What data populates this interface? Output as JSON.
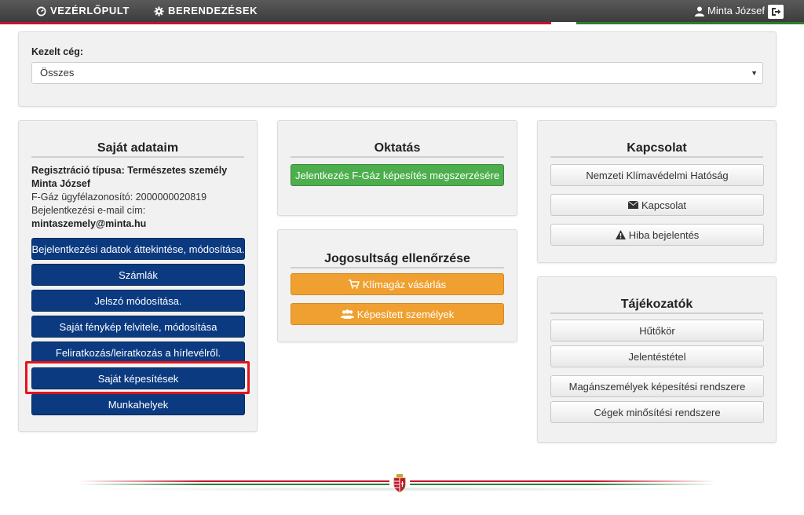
{
  "nav": {
    "dashboard_label": "VEZÉRLŐPULT",
    "devices_label": "BERENDEZÉSEK",
    "user_name": "Minta József"
  },
  "company": {
    "label": "Kezelt cég:",
    "selected": "Összes"
  },
  "own_data": {
    "title": "Saját adataim",
    "registration_type": "Regisztráció típusa: Természetes személy",
    "name": "Minta József",
    "client_id": "F-Gáz ügyfélazonosító: 2000000020819",
    "email_label": "Bejelentkezési e-mail cím:",
    "email": "mintaszemely@minta.hu",
    "buttons": [
      "Bejelentkezési adatok áttekintése, módosítása.",
      "Számlák",
      "Jelszó módosítása.",
      "Saját fénykép felvitele, módosítása",
      "Feliratkozás/leiratkozás a hírlevélről.",
      "Saját képesítések",
      "Munkahelyek"
    ]
  },
  "education": {
    "title": "Oktatás",
    "button": "Jelentkezés F-Gáz képesítés megszerzésére"
  },
  "eligibility": {
    "title": "Jogosultság ellenőrzése",
    "buy_button": "Klímagáz vásárlás",
    "persons_button": "Képesített személyek"
  },
  "contact": {
    "title": "Kapcsolat",
    "buttons": [
      "Nemzeti Klímavédelmi Hatóság",
      "Kapcsolat",
      "Hiba bejelentés"
    ]
  },
  "info": {
    "title": "Tájékozatók",
    "buttons": [
      "Hűtőkör",
      "Jelentéstétel",
      "Magánszemélyek képesítési rendszere",
      "Cégek minősítési rendszere"
    ]
  },
  "colors": {
    "navy": "#0b3a80",
    "green": "#4cae4c",
    "orange": "#f0a030",
    "highlight": "#e2141c"
  }
}
